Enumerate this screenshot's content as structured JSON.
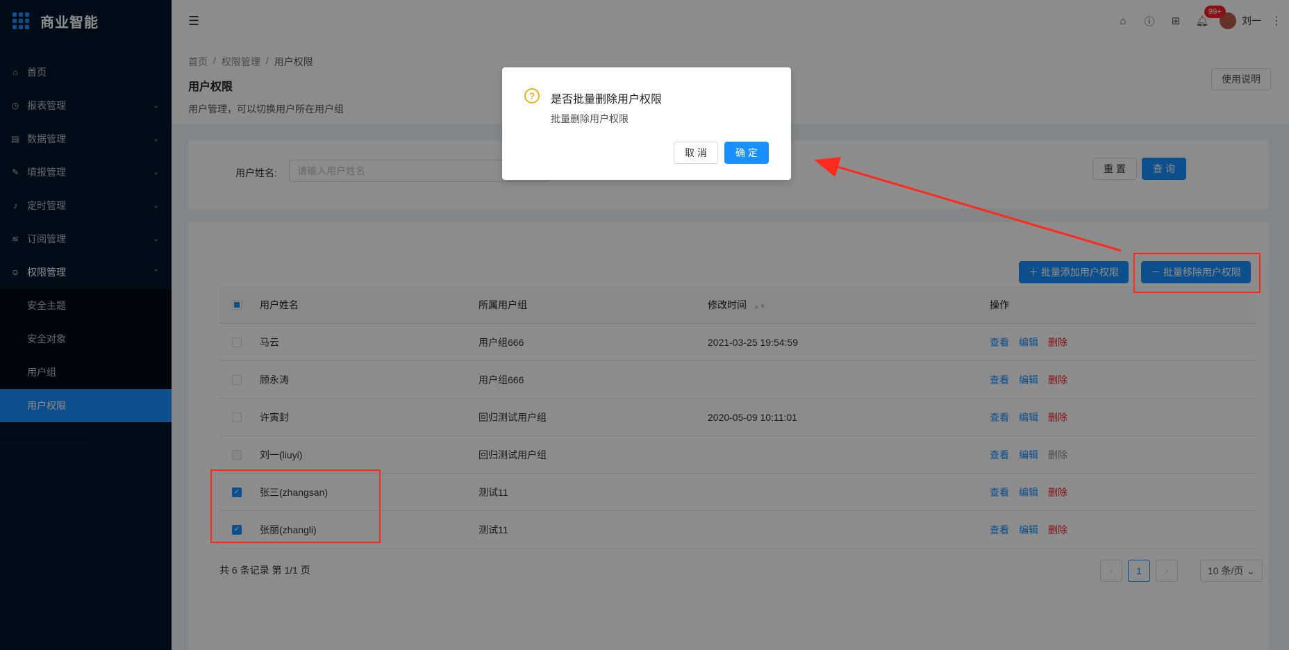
{
  "app": {
    "title": "商业智能"
  },
  "sidebar": {
    "items": [
      {
        "label": "首页",
        "icon": "bank-icon",
        "has_children": false
      },
      {
        "label": "报表管理",
        "icon": "dashboard-icon",
        "has_children": true
      },
      {
        "label": "数据管理",
        "icon": "database-icon",
        "has_children": true
      },
      {
        "label": "填报管理",
        "icon": "form-icon",
        "has_children": true
      },
      {
        "label": "定时管理",
        "icon": "bell-icon",
        "has_children": true
      },
      {
        "label": "订阅管理",
        "icon": "wifi-icon",
        "has_children": true
      },
      {
        "label": "权限管理",
        "icon": "user-icon",
        "has_children": true,
        "open": true
      }
    ],
    "sub_items": [
      {
        "label": "安全主题"
      },
      {
        "label": "安全对象"
      },
      {
        "label": "用户组"
      },
      {
        "label": "用户权限",
        "active": true
      }
    ]
  },
  "header": {
    "badge": "99+",
    "user_name": "刘一"
  },
  "breadcrumb": [
    "首页",
    "权限管理",
    "用户权限"
  ],
  "page": {
    "title": "用户权限",
    "description": "用户管理，可以切换用户所在用户组",
    "help_label": "使用说明"
  },
  "search": {
    "label": "用户姓名:",
    "placeholder": "请输入用户姓名",
    "reset_label": "重 置",
    "query_label": "查 询"
  },
  "toolbar": {
    "batch_add_label": "批量添加用户权限",
    "batch_remove_label": "批量移除用户权限"
  },
  "table": {
    "columns": [
      "用户姓名",
      "所属用户组",
      "修改时间",
      "操作"
    ],
    "rows": [
      {
        "name": "马云",
        "group": "用户组666",
        "time": "2021-03-25 19:54:59",
        "checked": false,
        "disabled": false
      },
      {
        "name": "顾永涛",
        "group": "用户组666",
        "time": "",
        "checked": false,
        "disabled": false
      },
      {
        "name": "许寅封",
        "group": "回归测试用户组",
        "time": "2020-05-09 10:11:01",
        "checked": false,
        "disabled": false
      },
      {
        "name": "刘一(liuyi)",
        "group": "回归测试用户组",
        "time": "",
        "checked": false,
        "disabled": true
      },
      {
        "name": "张三(zhangsan)",
        "group": "测试11",
        "time": "",
        "checked": true,
        "disabled": false
      },
      {
        "name": "张丽(zhangli)",
        "group": "测试11",
        "time": "",
        "checked": true,
        "disabled": false
      }
    ],
    "actions": {
      "view": "查看",
      "edit": "编辑",
      "delete": "删除"
    }
  },
  "pagination": {
    "summary": "共 6 条记录 第 1/1 页",
    "current": "1",
    "page_size": "10 条/页"
  },
  "modal": {
    "title": "是否批量删除用户权限",
    "content": "批量删除用户权限",
    "cancel_label": "取 消",
    "ok_label": "确 定"
  },
  "colors": {
    "primary": "#1890ff",
    "sidebar_bg": "#001529",
    "danger": "#f5222d",
    "warning": "#faad14",
    "annotation": "#ff2a1f"
  }
}
